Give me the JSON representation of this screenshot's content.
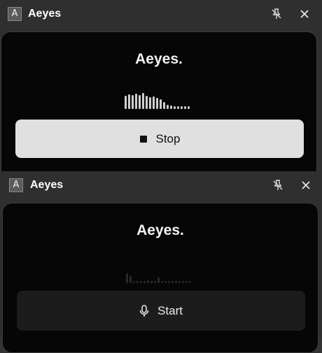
{
  "windows": [
    {
      "app_icon_letter": "A",
      "title": "Aeyes",
      "brand": "Aeyes.",
      "button_label": "Stop",
      "button_icon": "stop-icon"
    },
    {
      "app_icon_letter": "A",
      "title": "Aeyes",
      "brand": "Aeyes.",
      "button_label": "Start",
      "button_icon": "microphone-icon"
    }
  ],
  "icons": {
    "pin": "unpin-icon",
    "close": "close-icon"
  },
  "colors": {
    "stop_button_bg": "#e0e0e0",
    "start_button_bg": "#1c1c1c",
    "wave_active": "#cfcfcf",
    "wave_idle": "#2a2a2a"
  }
}
